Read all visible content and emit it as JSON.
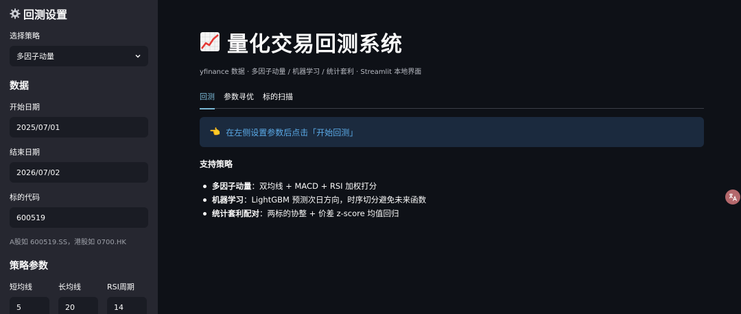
{
  "sidebar": {
    "title": "回测设置",
    "strategy_label": "选择策略",
    "strategy_value": "多因子动量",
    "data_header": "数据",
    "start_date_label": "开始日期",
    "start_date_value": "2025/07/01",
    "end_date_label": "结束日期",
    "end_date_value": "2026/07/02",
    "symbol_label": "标的代码",
    "symbol_value": "600519",
    "symbol_caption": "A股如 600519.SS，港股如 0700.HK",
    "params_header": "策略参数",
    "params": [
      {
        "label": "短均线",
        "value": "5"
      },
      {
        "label": "长均线",
        "value": "20"
      },
      {
        "label": "RSI周期",
        "value": "14"
      }
    ]
  },
  "main": {
    "title": "量化交易回测系统",
    "subtitle": "yfinance 数据 · 多因子动量 / 机器学习 / 统计套利 · Streamlit 本地界面",
    "tabs": [
      "回测",
      "参数寻优",
      "标的扫描"
    ],
    "info_text": "在左侧设置参数后点击「开始回测」",
    "section_title": "支持策略",
    "strategies": [
      {
        "name": "多因子动量",
        "desc": "：双均线 + MACD + RSI 加权打分"
      },
      {
        "name": "机器学习",
        "desc": "：LightGBM 预测次日方向，时序切分避免未来函数"
      },
      {
        "name": "统计套利配对",
        "desc": "：两标的协整 + 价差 z-score 均值回归"
      }
    ]
  },
  "colors": {
    "accent": "#7ab8d6",
    "info_bg": "#1b2a3e",
    "info_text": "#5aa9e6",
    "sidebar_bg": "#262730",
    "main_bg": "#0e1117"
  }
}
